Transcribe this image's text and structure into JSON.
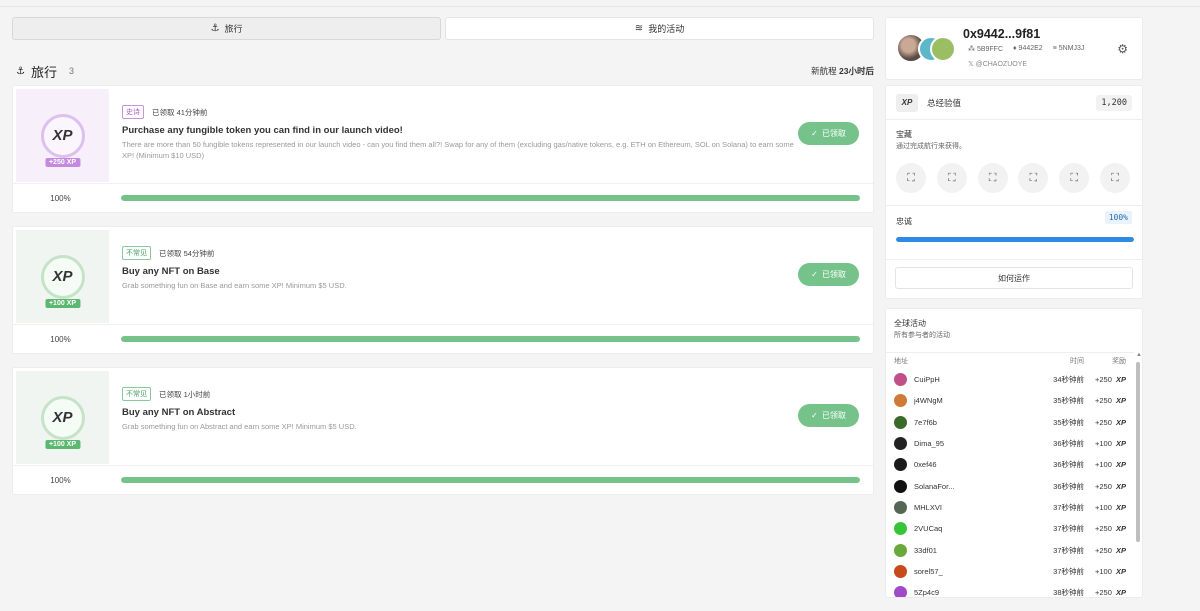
{
  "tabs": [
    {
      "label": "旅行",
      "icon": "anchor-icon"
    },
    {
      "label": "我的活动",
      "icon": "list-icon"
    }
  ],
  "section": {
    "title": "旅行",
    "count": "3",
    "next_prefix": "新航程",
    "next_bold": "23小时后"
  },
  "quests": [
    {
      "tag": "史诗",
      "claimed_ago": "已领取 41分钟前",
      "title": "Purchase any fungible token you can find in our launch video!",
      "description": "There are more than 50 fungible tokens represented in our launch video - can you find them all?! Swap for any of them (excluding gas/native tokens, e.g. ETH on Ethereum, SOL on Solana) to earn some XP! (Minimum $10 USD)",
      "xp": "+250 XP",
      "button": "已领取",
      "progress_label": "100%",
      "progress": 100,
      "theme": "purple"
    },
    {
      "tag": "不常见",
      "claimed_ago": "已领取 54分钟前",
      "title": "Buy any NFT on Base",
      "description": "Grab something fun on Base and earn some XP! Minimum $5 USD.",
      "xp": "+100 XP",
      "button": "已领取",
      "progress_label": "100%",
      "progress": 100,
      "theme": "green"
    },
    {
      "tag": "不常见",
      "claimed_ago": "已领取 1小时前",
      "title": "Buy any NFT on Abstract",
      "description": "Grab something fun on Abstract and earn some XP! Minimum $5 USD.",
      "xp": "+100 XP",
      "button": "已领取",
      "progress_label": "100%",
      "progress": 100,
      "theme": "green"
    }
  ],
  "profile": {
    "address": "0x9442...9f81",
    "stat1": "5B9FFC",
    "stat2": "9442E2",
    "stat3": "5NMJ3J",
    "handle": "@CHAOZUOYE"
  },
  "xp_panel": {
    "logo": "XP",
    "label": "总经验值",
    "value": "1,200"
  },
  "treasure": {
    "title": "宝藏",
    "subtitle": "通过完成航行来获得。",
    "slot_count": 6
  },
  "loyalty": {
    "label": "忠诚",
    "value_label": "100%",
    "value": 100
  },
  "how_button": "如何运作",
  "activity": {
    "title": "全球活动",
    "subtitle": "所有参与者的活动",
    "col_addr": "地址",
    "col_time": "时间",
    "col_reward": "奖励",
    "rows": [
      {
        "name": "CuiPpH",
        "time": "34秒钟前",
        "reward": "+250",
        "color": "#c0508a"
      },
      {
        "name": "j4WNgM",
        "time": "35秒钟前",
        "reward": "+250",
        "color": "#d07a3a"
      },
      {
        "name": "7e7f6b",
        "time": "35秒钟前",
        "reward": "+250",
        "color": "#3a6a2a"
      },
      {
        "name": "Dima_95",
        "time": "36秒钟前",
        "reward": "+100",
        "color": "#222222"
      },
      {
        "name": "0xef46",
        "time": "36秒钟前",
        "reward": "+100",
        "color": "#1a1a1a"
      },
      {
        "name": "SolanaFor...",
        "time": "36秒钟前",
        "reward": "+250",
        "color": "#111111"
      },
      {
        "name": "MHLXVI",
        "time": "37秒钟前",
        "reward": "+100",
        "color": "#556655"
      },
      {
        "name": "2VUCaq",
        "time": "37秒钟前",
        "reward": "+250",
        "color": "#38c438"
      },
      {
        "name": "33df01",
        "time": "37秒钟前",
        "reward": "+250",
        "color": "#6aa83a"
      },
      {
        "name": "sorel57_",
        "time": "37秒钟前",
        "reward": "+100",
        "color": "#c84a1a"
      },
      {
        "name": "5Zp4c9",
        "time": "38秒钟前",
        "reward": "+250",
        "color": "#a04ac8"
      }
    ],
    "reward_unit": "XP"
  }
}
